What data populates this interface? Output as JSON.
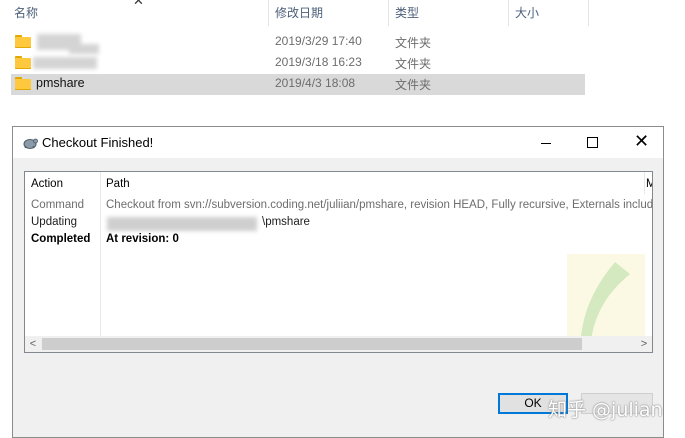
{
  "explorer": {
    "columns": {
      "name": "名称",
      "date": "修改日期",
      "type": "类型",
      "size": "大小"
    },
    "rows": [
      {
        "name": "",
        "date": "2019/3/29 17:40",
        "type": "文件夹"
      },
      {
        "name": "",
        "date": "2019/3/18 16:23",
        "type": "文件夹"
      },
      {
        "name": "pmshare",
        "date": "2019/4/3 18:08",
        "type": "文件夹"
      }
    ]
  },
  "dialog": {
    "title": "Checkout Finished!",
    "columns": {
      "action": "Action",
      "path": "Path",
      "extra": "M"
    },
    "rows": [
      {
        "action": "Command",
        "path": "Checkout from svn://subversion.coding.net/juliian/pmshare, revision HEAD, Fully recursive, Externals included"
      },
      {
        "action": "Updating",
        "path": "\\pmshare"
      },
      {
        "action": "Completed",
        "path": "At revision: 0"
      }
    ],
    "scroll_left": "<",
    "scroll_right": ">",
    "ok_label": "OK",
    "close_glyph": "✕"
  },
  "watermark": "知乎 @julian",
  "colors": {
    "selection": "#d9d9d9",
    "accent": "#0078d7",
    "folder": "#ffc83d"
  }
}
